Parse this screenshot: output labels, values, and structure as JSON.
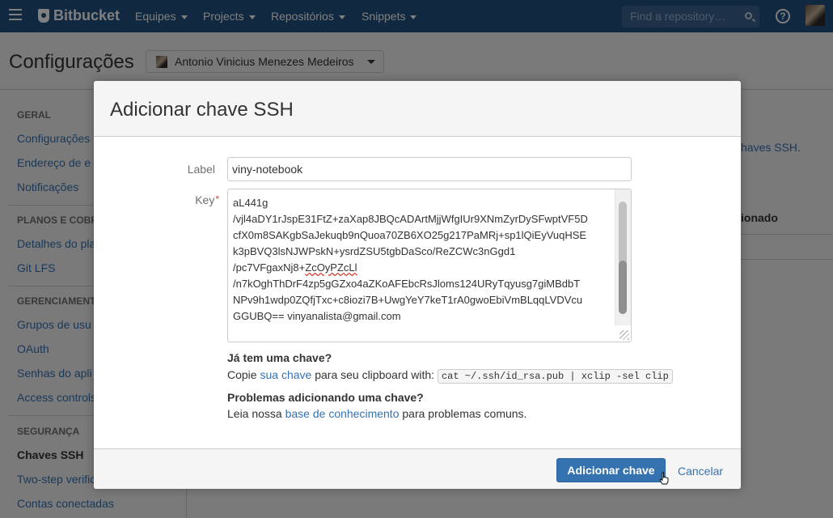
{
  "topbar": {
    "brand": "Bitbucket",
    "nav": [
      "Equipes",
      "Projects",
      "Repositórios",
      "Snippets"
    ],
    "search_placeholder": "Find a repository…",
    "help_glyph": "?"
  },
  "page": {
    "title": "Configurações",
    "account": "Antonio Vinicius Menezes Medeiros"
  },
  "sidebar": {
    "geral": "GERAL",
    "item_config": "Configurações",
    "item_endereco": "Endereço de e",
    "item_notificacoes": "Notificações",
    "planos": "PLANOS E COBRA",
    "item_detalhes": "Detalhes do pla",
    "item_gitlfs": "Git LFS",
    "gerenciamento": "GERENCIAMENTO",
    "item_grupos": "Grupos de usu",
    "item_oauth": "OAuth",
    "item_senhas": "Senhas do apli",
    "item_access": "Access controls",
    "seguranca": "SEGURANÇA",
    "item_chaves": "Chaves SSH",
    "item_twostep": "Two-step verific",
    "item_contas": "Contas conectadas"
  },
  "background": {
    "link_fragment": "haves SSH.",
    "col_fragment": "ionado"
  },
  "dialog": {
    "title": "Adicionar chave SSH",
    "label_label": "Label",
    "label_value": "viny-notebook",
    "key_label": "Key",
    "key_required": "*",
    "key_lines": [
      "aL441g",
      "/vjl4aDY1rJspE31FtZ+zaXap8JBQcADArtMjjWfgIUr9XNmZyrDySFwptVF5D",
      "cfX0m8SAKgbSaJekuqb9nQuoa70ZB6XO25g217PaMRj+sp1lQiEyVuqHSE",
      "k3pBVQ3lsNJWPskN+ysrdZSU5tgbDaSco/ReZCWc3nGgd1"
    ],
    "key_line5_prefix": "/pc7VFgaxNj8+",
    "key_line5_spell": "ZcOyPZcLl",
    "key_lines_after": [
      "/n7kOghThDrF4zp5gGZxo4aZKoAFEbcRsJloms124URyTqyusg7giMBdbT",
      "NPv9h1wdp0ZQfjTxc+c8iozi7B+UwgYeY7keT1rA0gwoEbiVmBLqqLVDVcu",
      "GGUBQ== vinyanalista@gmail.com"
    ],
    "have_key_title": "Já tem uma chave?",
    "have_key_prefix": "Copie",
    "have_key_link": "sua chave",
    "have_key_middle": "para seu clipboard with:",
    "have_key_code": "cat ~/.ssh/id_rsa.pub | xclip -sel clip",
    "problems_title": "Problemas adicionando uma chave?",
    "problems_prefix": "Leia nossa",
    "problems_link": "base de conhecimento",
    "problems_suffix": "para problemas comuns.",
    "submit": "Adicionar chave",
    "cancel": "Cancelar"
  }
}
